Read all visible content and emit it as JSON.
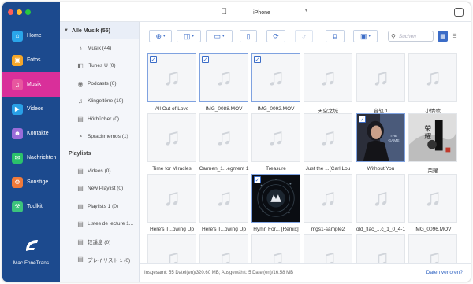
{
  "device": {
    "name": "iPhone"
  },
  "colors": {
    "nav_bg": "#1c4a8e",
    "nav_active": "#d92f9a",
    "accent": "#3b6cc7"
  },
  "nav": {
    "items": [
      {
        "label": "Home",
        "icon": "home-icon",
        "color": "#2aa5ea",
        "active": false
      },
      {
        "label": "Fotos",
        "icon": "photos-icon",
        "color": "#f4a629",
        "active": false
      },
      {
        "label": "Musik",
        "icon": "music-icon",
        "color": "#e8579f",
        "active": true
      },
      {
        "label": "Videos",
        "icon": "video-icon",
        "color": "#29a0e6",
        "active": false
      },
      {
        "label": "Kontakte",
        "icon": "contacts-icon",
        "color": "#9a6cd9",
        "active": false
      },
      {
        "label": "Nachrichten",
        "icon": "messages-icon",
        "color": "#2bc26b",
        "active": false
      },
      {
        "label": "Sonstige",
        "icon": "more-icon",
        "color": "#f07a3a",
        "active": false
      },
      {
        "label": "Toolkit",
        "icon": "toolkit-icon",
        "color": "#3cc47c",
        "active": false
      }
    ],
    "brand": "Mac FoneTrans"
  },
  "library": {
    "header": "Alle Musik (55)",
    "items": [
      {
        "label": "Musik (44)",
        "icon": "music-note-icon"
      },
      {
        "label": "iTunes U (0)",
        "icon": "itunes-u-icon"
      },
      {
        "label": "Podcasts (0)",
        "icon": "podcast-icon"
      },
      {
        "label": "Klingeltöne (10)",
        "icon": "bell-icon"
      },
      {
        "label": "Hörbücher (0)",
        "icon": "book-icon"
      },
      {
        "label": "Sprachmemos (1)",
        "icon": "voice-memo-icon"
      }
    ],
    "playlists_header": "Playlists",
    "playlists": [
      {
        "label": "Videos (0)"
      },
      {
        "label": "New Playlist (0)"
      },
      {
        "label": "Playlists 1 (0)"
      },
      {
        "label": "Listes de lecture 1..."
      },
      {
        "label": "较遥息 (0)"
      },
      {
        "label": "プレイリスト 1 (0)"
      }
    ]
  },
  "toolbar": {
    "search_placeholder": "Suchen",
    "buttons": [
      {
        "name": "add-button",
        "icon": "plus-circle-icon"
      },
      {
        "name": "export-to-device-button",
        "icon": "phone-export-icon"
      },
      {
        "name": "export-to-pc-button",
        "icon": "monitor-export-icon"
      },
      {
        "name": "export-to-itunes-button",
        "icon": "itunes-icon"
      },
      {
        "name": "sync-button",
        "icon": "sync-icon"
      },
      {
        "name": "ringtone-button",
        "icon": "bell-icon"
      },
      {
        "name": "copy-button",
        "icon": "copy-icon"
      },
      {
        "name": "toolbox-button",
        "icon": "toolbox-icon"
      }
    ]
  },
  "grid": {
    "tiles": [
      {
        "title": "All Out of Love",
        "checked": true,
        "art": "none"
      },
      {
        "title": "IMG_0088.MOV",
        "checked": true,
        "art": "none"
      },
      {
        "title": "IMG_0092.MOV",
        "checked": true,
        "art": "none"
      },
      {
        "title": "天空之城",
        "checked": false,
        "art": "none"
      },
      {
        "title": "音轨 1",
        "checked": false,
        "art": "none"
      },
      {
        "title": "小情歌",
        "checked": false,
        "art": "none"
      },
      {
        "title": "Time for Miracles",
        "checked": false,
        "art": "none"
      },
      {
        "title": "Carmen_1...egment 1",
        "checked": false,
        "art": "none"
      },
      {
        "title": "Treasure",
        "checked": false,
        "art": "none"
      },
      {
        "title": "Just the ...(Carl Lou",
        "checked": false,
        "art": "none"
      },
      {
        "title": "Without You",
        "checked": true,
        "art": "album-cover-woman"
      },
      {
        "title": "荣耀",
        "checked": false,
        "art": "album-cover-chinese"
      },
      {
        "title": "Here's T...owing Up",
        "checked": false,
        "art": "none"
      },
      {
        "title": "Here's T...owing Up",
        "checked": false,
        "art": "none"
      },
      {
        "title": "Hymn For... [Remix]",
        "checked": true,
        "art": "album-cover-alan-walker"
      },
      {
        "title": "mgs1-sample2",
        "checked": false,
        "art": "none"
      },
      {
        "title": "old_flac_...c_1_0_4-1",
        "checked": false,
        "art": "none"
      },
      {
        "title": "IMG_0096.MOV",
        "checked": false,
        "art": "none"
      },
      {
        "title": "",
        "checked": false,
        "art": "none"
      },
      {
        "title": "",
        "checked": false,
        "art": "none"
      },
      {
        "title": "",
        "checked": false,
        "art": "none"
      },
      {
        "title": "",
        "checked": false,
        "art": "none"
      },
      {
        "title": "",
        "checked": false,
        "art": "none"
      },
      {
        "title": "",
        "checked": false,
        "art": "none"
      }
    ]
  },
  "status": {
    "summary": "Insgesamt: 55 Datei(en)/320.60 MB; Ausgewählt: 5 Datei(en)/16.58 MB",
    "lost_link": "Daten verloren?"
  }
}
